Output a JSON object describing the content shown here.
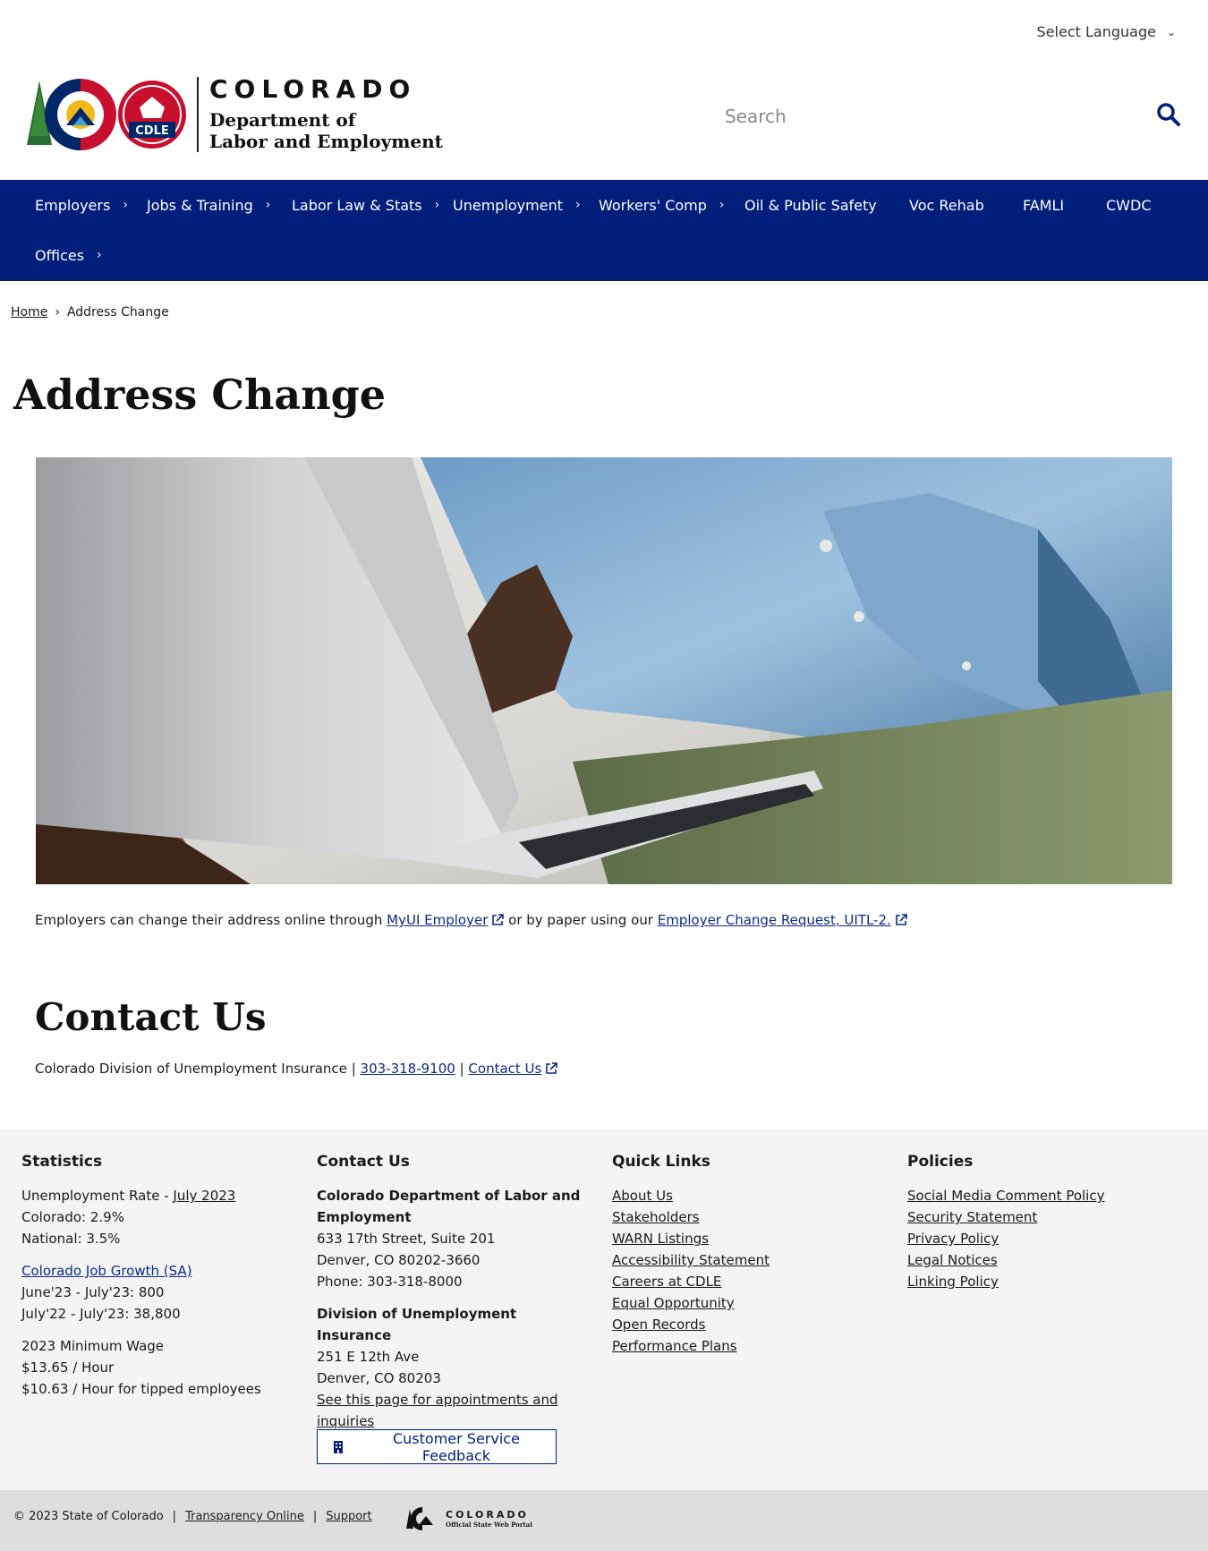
{
  "language": {
    "label": "Select Language"
  },
  "logo": {
    "state": "COLORADO",
    "dept_line1": "Department of",
    "dept_line2": "Labor and Employment",
    "badge": "CDLE"
  },
  "search": {
    "placeholder": "Search"
  },
  "nav": {
    "items": [
      {
        "label": "Employers",
        "has_submenu": true
      },
      {
        "label": "Jobs & Training",
        "has_submenu": true
      },
      {
        "label": "Labor Law & Stats",
        "has_submenu": true
      },
      {
        "label": "Unemployment",
        "has_submenu": true
      },
      {
        "label": "Workers' Comp",
        "has_submenu": true
      },
      {
        "label": "Oil & Public Safety",
        "has_submenu": false
      },
      {
        "label": "Voc Rehab",
        "has_submenu": false
      },
      {
        "label": "FAMLI",
        "has_submenu": false
      },
      {
        "label": "CWDC",
        "has_submenu": false
      },
      {
        "label": "Offices",
        "has_submenu": true
      }
    ],
    "chevron": "›"
  },
  "breadcrumb": {
    "home": "Home",
    "sep": "›",
    "current": "Address Change"
  },
  "page": {
    "title": "Address Change"
  },
  "intro": {
    "t1": "Employers can change their address online through ",
    "link1": "MyUI Employer",
    "t2": " or by paper using our ",
    "link2": "Employer Change Request, UITL-2."
  },
  "contact": {
    "heading": "Contact Us",
    "org": "Colorado Division of Unemployment Insurance",
    "sep": "|",
    "phone": "303-318-9100",
    "link": "Contact Us"
  },
  "footer": {
    "statistics": {
      "heading": "Statistics",
      "rate_label": "Unemployment Rate - ",
      "rate_link": "July 2023",
      "colorado": "Colorado: 2.9%",
      "national": "National: 3.5%",
      "job_growth_link": "Colorado Job Growth (SA)",
      "growth1": "June'23 - July'23: 800",
      "growth2": "July'22 - July'23: 38,800",
      "min_wage_label": "2023 Minimum Wage",
      "min_wage": "$13.65 / Hour",
      "tipped": "$10.63 / Hour for tipped employees"
    },
    "contact": {
      "heading": "Contact Us",
      "org1": "Colorado Department of Labor and Employment",
      "addr1": "633 17th Street, Suite 201",
      "city1": "Denver, CO  80202-3660",
      "phone1": "Phone: 303-318-8000",
      "org2": "Division of Unemployment Insurance",
      "addr2": "251 E 12th Ave",
      "city2": "Denver, CO  80203",
      "appt_link": "See this page for appointments and inquiries",
      "feedback_button": "Customer Service Feedback"
    },
    "quick_links": {
      "heading": "Quick Links",
      "items": [
        "About Us",
        "Stakeholders",
        "WARN Listings",
        "Accessibility Statement",
        "Careers at CDLE",
        "Equal Opportunity",
        "Open Records",
        "Performance Plans"
      ]
    },
    "policies": {
      "heading": "Policies",
      "items": [
        "Social Media Comment Policy",
        "Security Statement",
        "Privacy Policy",
        "Legal Notices",
        "Linking Policy"
      ]
    }
  },
  "bottom": {
    "copyright": "© 2023 State of Colorado",
    "sep": "|",
    "transparency": "Transparency Online",
    "support": "Support",
    "portal_title": "COLORADO",
    "portal_sub": "Official State Web Portal"
  },
  "colors": {
    "nav_bg": "#001e7a",
    "link": "#0b2a8a",
    "footer_bg": "#f4f4f4",
    "bottom_bg": "#dedede"
  }
}
